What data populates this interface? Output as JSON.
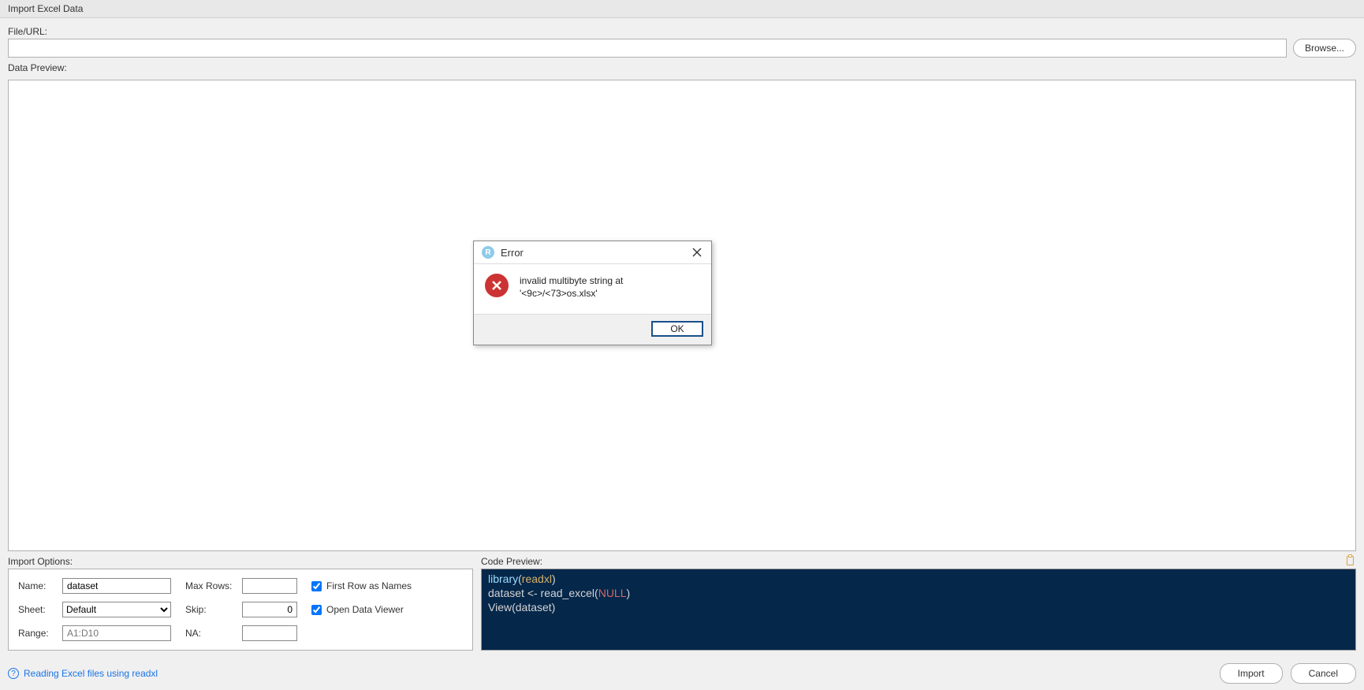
{
  "title": "Import Excel Data",
  "file_url_label": "File/URL:",
  "file_url_value": "",
  "browse_label": "Browse...",
  "data_preview_label": "Data Preview:",
  "import_options_label": "Import Options:",
  "options": {
    "name_label": "Name:",
    "name_value": "dataset",
    "sheet_label": "Sheet:",
    "sheet_value": "Default",
    "range_label": "Range:",
    "range_placeholder": "A1:D10",
    "range_value": "",
    "maxrows_label": "Max Rows:",
    "maxrows_value": "",
    "skip_label": "Skip:",
    "skip_value": "0",
    "na_label": "NA:",
    "na_value": "",
    "first_row_label": "First Row as Names",
    "first_row_checked": true,
    "open_viewer_label": "Open Data Viewer",
    "open_viewer_checked": true
  },
  "code_preview_label": "Code Preview:",
  "code": {
    "line1_fn": "library",
    "line1_arg": "readxl",
    "line2_lhs": "dataset <- read_excel(",
    "line2_null": "NULL",
    "line3": "View(dataset)"
  },
  "help_text": "Reading Excel files using readxl",
  "import_btn": "Import",
  "cancel_btn": "Cancel",
  "dialog": {
    "title": "Error",
    "message": "invalid multibyte string at '<9c>/<73>os.xlsx'",
    "ok": "OK"
  }
}
